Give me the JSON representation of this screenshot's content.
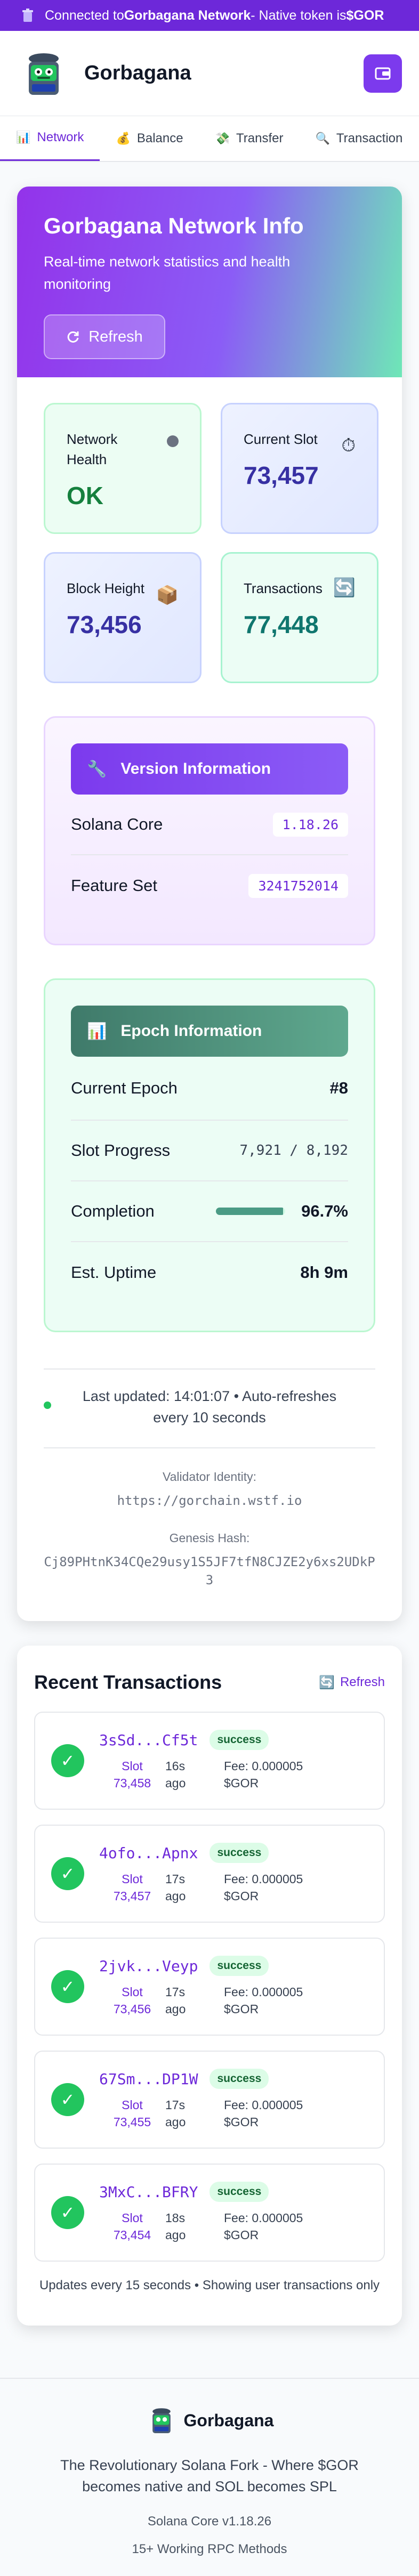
{
  "banner": {
    "prefix": "Connected to ",
    "network": "Gorbagana Network",
    "suffix": " - Native token is ",
    "token": "$GOR"
  },
  "header": {
    "brand": "Gorbagana"
  },
  "tabs": [
    {
      "label": "Network",
      "icon": "bar-chart-icon",
      "active": true
    },
    {
      "label": "Balance",
      "icon": "money-bag-icon",
      "active": false
    },
    {
      "label": "Transfer",
      "icon": "money-wings-icon",
      "active": false
    },
    {
      "label": "Transaction",
      "icon": "magnifier-icon",
      "active": false
    }
  ],
  "hero": {
    "title": "Gorbagana Network Info",
    "subtitle": "Real-time network statistics and health monitoring",
    "refresh_label": "Refresh"
  },
  "stats": {
    "health": {
      "label": "Network Health",
      "value": "OK"
    },
    "slot": {
      "label": "Current Slot",
      "value": "73,457"
    },
    "block": {
      "label": "Block Height",
      "value": "73,456"
    },
    "transactions": {
      "label": "Transactions",
      "value": "77,448"
    }
  },
  "version": {
    "title": "Version Information",
    "core_label": "Solana Core",
    "core_value": "1.18.26",
    "feature_label": "Feature Set",
    "feature_value": "3241752014"
  },
  "epoch": {
    "title": "Epoch Information",
    "current_label": "Current Epoch",
    "current_value": "#8",
    "progress_label": "Slot Progress",
    "progress_value": "7,921 / 8,192",
    "completion_label": "Completion",
    "completion_value": "96.7%",
    "completion_fraction": 0.967,
    "uptime_label": "Est. Uptime",
    "uptime_value": "8h 9m"
  },
  "status": {
    "updated": "Last updated: 14:01:07 • Auto-refreshes every 10 seconds",
    "validator_label": "Validator Identity:",
    "validator_value": "https://gorchain.wstf.io",
    "genesis_label": "Genesis Hash:",
    "genesis_value": "Cj89PHtnK34CQe29usy1S5JF7tfN8CJZE2y6xs2UDkP3"
  },
  "recent": {
    "title": "Recent Transactions",
    "refresh_label": "Refresh",
    "slot_label": "Slot",
    "items": [
      {
        "sig": "3sSd...Cf5t",
        "status": "success",
        "slot": "73,458",
        "ago": "16s ago",
        "fee": "Fee: 0.000005 $GOR"
      },
      {
        "sig": "4ofo...Apnx",
        "status": "success",
        "slot": "73,457",
        "ago": "17s ago",
        "fee": "Fee: 0.000005 $GOR"
      },
      {
        "sig": "2jvk...Veyp",
        "status": "success",
        "slot": "73,456",
        "ago": "17s ago",
        "fee": "Fee: 0.000005 $GOR"
      },
      {
        "sig": "67Sm...DP1W",
        "status": "success",
        "slot": "73,455",
        "ago": "17s ago",
        "fee": "Fee: 0.000005 $GOR"
      },
      {
        "sig": "3MxC...BFRY",
        "status": "success",
        "slot": "73,454",
        "ago": "18s ago",
        "fee": "Fee: 0.000005 $GOR"
      }
    ],
    "footnote": "Updates every 15 seconds • Showing user transactions only"
  },
  "footer": {
    "brand": "Gorbagana",
    "tagline": "The Revolutionary Solana Fork - Where $GOR becomes native and SOL becomes SPL",
    "core": "Solana Core v1.18.26",
    "methods": "15+ Working RPC Methods"
  }
}
